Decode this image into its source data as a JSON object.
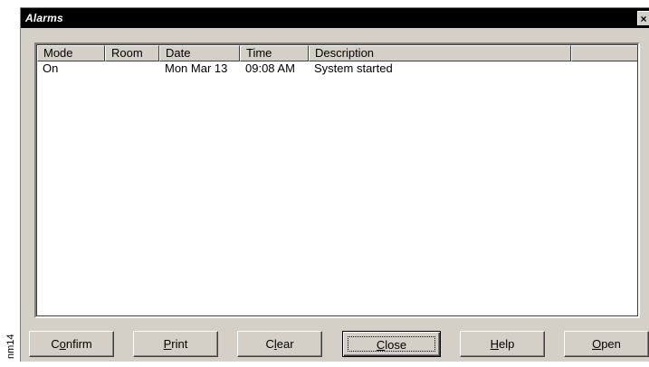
{
  "side_label": "nm14",
  "window": {
    "title": "Alarms",
    "close_glyph": "×"
  },
  "alarm_list": {
    "columns": [
      {
        "label": "Mode"
      },
      {
        "label": "Room"
      },
      {
        "label": "Date"
      },
      {
        "label": "Time"
      },
      {
        "label": "Description"
      },
      {
        "label": ""
      }
    ],
    "rows": [
      {
        "mode": "On",
        "room": "",
        "date": "Mon Mar 13",
        "time": "09:08 AM",
        "description": "System started"
      }
    ]
  },
  "buttons": {
    "confirm": {
      "before": "C",
      "mnemonic": "o",
      "after": "nfirm"
    },
    "print": {
      "before": "",
      "mnemonic": "P",
      "after": "rint"
    },
    "clear": {
      "before": "C",
      "mnemonic": "l",
      "after": "ear"
    },
    "close": {
      "before": "",
      "mnemonic": "C",
      "after": "lose"
    },
    "help": {
      "before": "",
      "mnemonic": "H",
      "after": "elp"
    },
    "open": {
      "before": "",
      "mnemonic": "O",
      "after": "pen"
    }
  },
  "colors": {
    "titlebar_bg": "#000000",
    "titlebar_text": "#ffffff",
    "dialog_face": "#d4d0c8",
    "list_bg": "#ffffff"
  },
  "icons": {
    "close": "close-icon"
  }
}
